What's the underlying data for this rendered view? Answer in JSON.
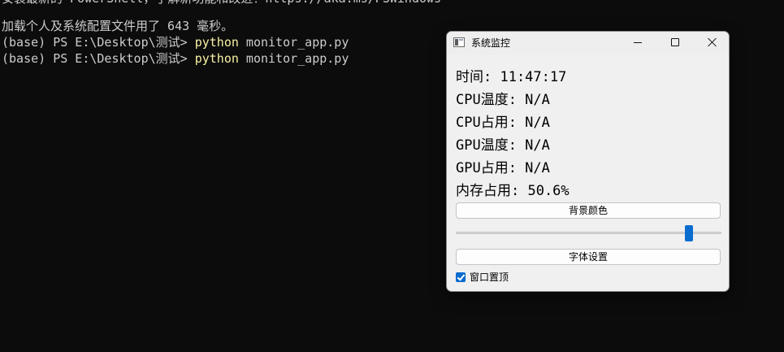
{
  "terminal": {
    "cut_line": "安装最新的 PowerShell，了解新功能和改进！https://aka.ms/PSWindows",
    "load_message": "加载个人及系统配置文件用了 643 毫秒。",
    "prompt": "(base) PS E:\\Desktop\\测试> ",
    "command": "python",
    "args": " monitor_app.py"
  },
  "window": {
    "title": "系统监控",
    "icon": "app-window-icon",
    "minimize_icon": "minimize-icon",
    "maximize_icon": "maximize-icon",
    "close_icon": "close-icon"
  },
  "monitor": {
    "time": "时间: 11:47:17",
    "cpu_temp": "CPU温度: N/A",
    "cpu_usage": "CPU占用: N/A",
    "gpu_temp": "GPU温度: N/A",
    "gpu_usage": "GPU占用: N/A",
    "mem_usage": "内存占用: 50.6%"
  },
  "controls": {
    "bg_color_label": "背景颜色",
    "slider_value_fraction": 0.89,
    "font_settings_label": "字体设置",
    "always_on_top_label": "窗口置顶",
    "always_on_top_checked": true
  },
  "colors": {
    "terminal_bg": "#0c0c0c",
    "terminal_text": "#cccccc",
    "command_yellow": "#f9f1a5",
    "accent_blue": "#0a6ccf",
    "window_bg": "#f0f0f0"
  }
}
